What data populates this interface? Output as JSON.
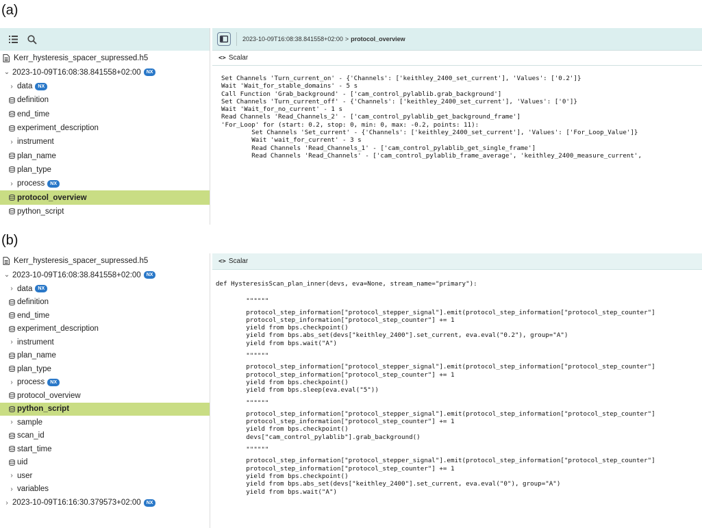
{
  "panel_a": {
    "label": "(a)",
    "sidebar": {
      "file_name": "Kerr_hysteresis_spacer_supressed.h5",
      "entry_name": "2023-10-09T16:08:38.841558+02:00",
      "entry_badge": "NX",
      "items": [
        {
          "label": "data",
          "kind": "group",
          "badge": "NX"
        },
        {
          "label": "definition",
          "kind": "dataset"
        },
        {
          "label": "end_time",
          "kind": "dataset"
        },
        {
          "label": "experiment_description",
          "kind": "dataset"
        },
        {
          "label": "instrument",
          "kind": "group"
        },
        {
          "label": "plan_name",
          "kind": "dataset"
        },
        {
          "label": "plan_type",
          "kind": "dataset"
        },
        {
          "label": "process",
          "kind": "group",
          "badge": "NX"
        },
        {
          "label": "protocol_overview",
          "kind": "dataset",
          "selected": true
        },
        {
          "label": "python_script",
          "kind": "dataset"
        }
      ]
    },
    "breadcrumb": {
      "entry": "2023-10-09T16:08:38.841558+02:00",
      "arrow": ">",
      "current": "protocol_overview"
    },
    "tab_label": "Scalar",
    "code_lines": [
      "Set Channels 'Turn_current_on' - {'Channels': ['keithley_2400_set_current'], 'Values': ['0.2']}",
      "Wait 'Wait_for_stable_domains' - 5 s",
      "Call Function 'Grab_background' - ['cam_control_pylablib.grab_background']",
      "Set Channels 'Turn_current_off' - {'Channels': ['keithley_2400_set_current'], 'Values': ['0']}",
      "Wait 'Wait_for_no_current' - 1 s",
      "Read Channels 'Read_Channels_2' - ['cam_control_pylablib_get_background_frame']",
      "'For_Loop' for (start: 0.2, stop: 0, min: 0, max: -0.2, points: 11):",
      "        Set Channels 'Set_current' - {'Channels': ['keithley_2400_set_current'], 'Values': ['For_Loop_Value']}",
      "        Wait 'wait_for_current' - 3 s",
      "        Read Channels 'Read_Channels_1' - ['cam_control_pylablib_get_single_frame']",
      "        Read Channels 'Read_Channels' - ['cam_control_pylablib_frame_average', 'keithley_2400_measure_current',"
    ]
  },
  "panel_b": {
    "label": "(b)",
    "sidebar": {
      "file_name": "Kerr_hysteresis_spacer_supressed.h5",
      "entry_name": "2023-10-09T16:08:38.841558+02:00",
      "entry_badge": "NX",
      "items": [
        {
          "label": "data",
          "kind": "group",
          "badge": "NX"
        },
        {
          "label": "definition",
          "kind": "dataset"
        },
        {
          "label": "end_time",
          "kind": "dataset"
        },
        {
          "label": "experiment_description",
          "kind": "dataset"
        },
        {
          "label": "instrument",
          "kind": "group"
        },
        {
          "label": "plan_name",
          "kind": "dataset"
        },
        {
          "label": "plan_type",
          "kind": "dataset"
        },
        {
          "label": "process",
          "kind": "group",
          "badge": "NX"
        },
        {
          "label": "protocol_overview",
          "kind": "dataset"
        },
        {
          "label": "python_script",
          "kind": "dataset",
          "selected": true
        },
        {
          "label": "sample",
          "kind": "group"
        },
        {
          "label": "scan_id",
          "kind": "dataset"
        },
        {
          "label": "start_time",
          "kind": "dataset"
        },
        {
          "label": "uid",
          "kind": "dataset"
        },
        {
          "label": "user",
          "kind": "group"
        },
        {
          "label": "variables",
          "kind": "group"
        }
      ],
      "second_entry_name": "2023-10-09T16:16:30.379573+02:00",
      "second_entry_badge": "NX"
    },
    "tab_label": "Scalar",
    "code_blocks": [
      [
        "def HysteresisScan_plan_inner(devs, eva=None, stream_name=\"primary\"):"
      ],
      [
        "        \"\"\"\"\"\"",
        "        protocol_step_information[\"protocol_stepper_signal\"].emit(protocol_step_information[\"protocol_step_counter\"]",
        "        protocol_step_information[\"protocol_step_counter\"] += 1",
        "        yield from bps.checkpoint()",
        "        yield from bps.abs_set(devs[\"keithley_2400\"].set_current, eva.eval(\"0.2\"), group=\"A\")",
        "        yield from bps.wait(\"A\")"
      ],
      [
        "        \"\"\"\"\"\"",
        "        protocol_step_information[\"protocol_stepper_signal\"].emit(protocol_step_information[\"protocol_step_counter\"]",
        "        protocol_step_information[\"protocol_step_counter\"] += 1",
        "        yield from bps.checkpoint()",
        "        yield from bps.sleep(eva.eval(\"5\"))"
      ],
      [
        "        \"\"\"\"\"\"",
        "        protocol_step_information[\"protocol_stepper_signal\"].emit(protocol_step_information[\"protocol_step_counter\"]",
        "        protocol_step_information[\"protocol_step_counter\"] += 1",
        "        yield from bps.checkpoint()",
        "        devs[\"cam_control_pylablib\"].grab_background()"
      ],
      [
        "        \"\"\"\"\"\"",
        "        protocol_step_information[\"protocol_stepper_signal\"].emit(protocol_step_information[\"protocol_step_counter\"]",
        "        protocol_step_information[\"protocol_step_counter\"] += 1",
        "        yield from bps.checkpoint()",
        "        yield from bps.abs_set(devs[\"keithley_2400\"].set_current, eva.eval(\"0\"), group=\"A\")",
        "        yield from bps.wait(\"A\")"
      ]
    ]
  }
}
